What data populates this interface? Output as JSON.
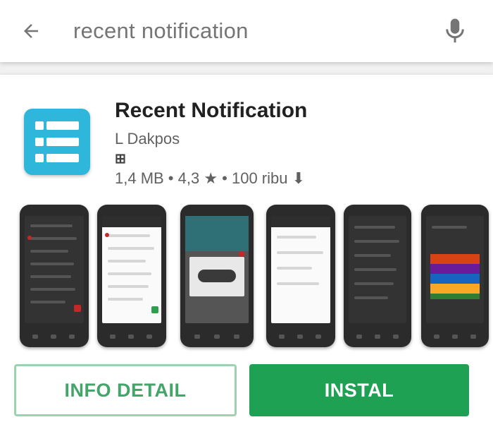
{
  "search": {
    "query": "recent notification"
  },
  "app": {
    "title": "Recent Notification",
    "developer": "L Dakpos",
    "badge": "⊞",
    "meta": "1,4 MB • 4,3 ★ • 100 ribu ⬇",
    "icon": "list-icon",
    "icon_color": "#2fb6db"
  },
  "screenshots": [
    {
      "label": "screenshot-1"
    },
    {
      "label": "screenshot-2"
    },
    {
      "label": "screenshot-3"
    },
    {
      "label": "screenshot-4"
    },
    {
      "label": "screenshot-5"
    },
    {
      "label": "screenshot-6"
    }
  ],
  "buttons": {
    "info_label": "INFO DETAIL",
    "install_label": "INSTAL"
  },
  "colors": {
    "accent_green": "#1fa153",
    "icon_blue": "#2fb6db"
  }
}
